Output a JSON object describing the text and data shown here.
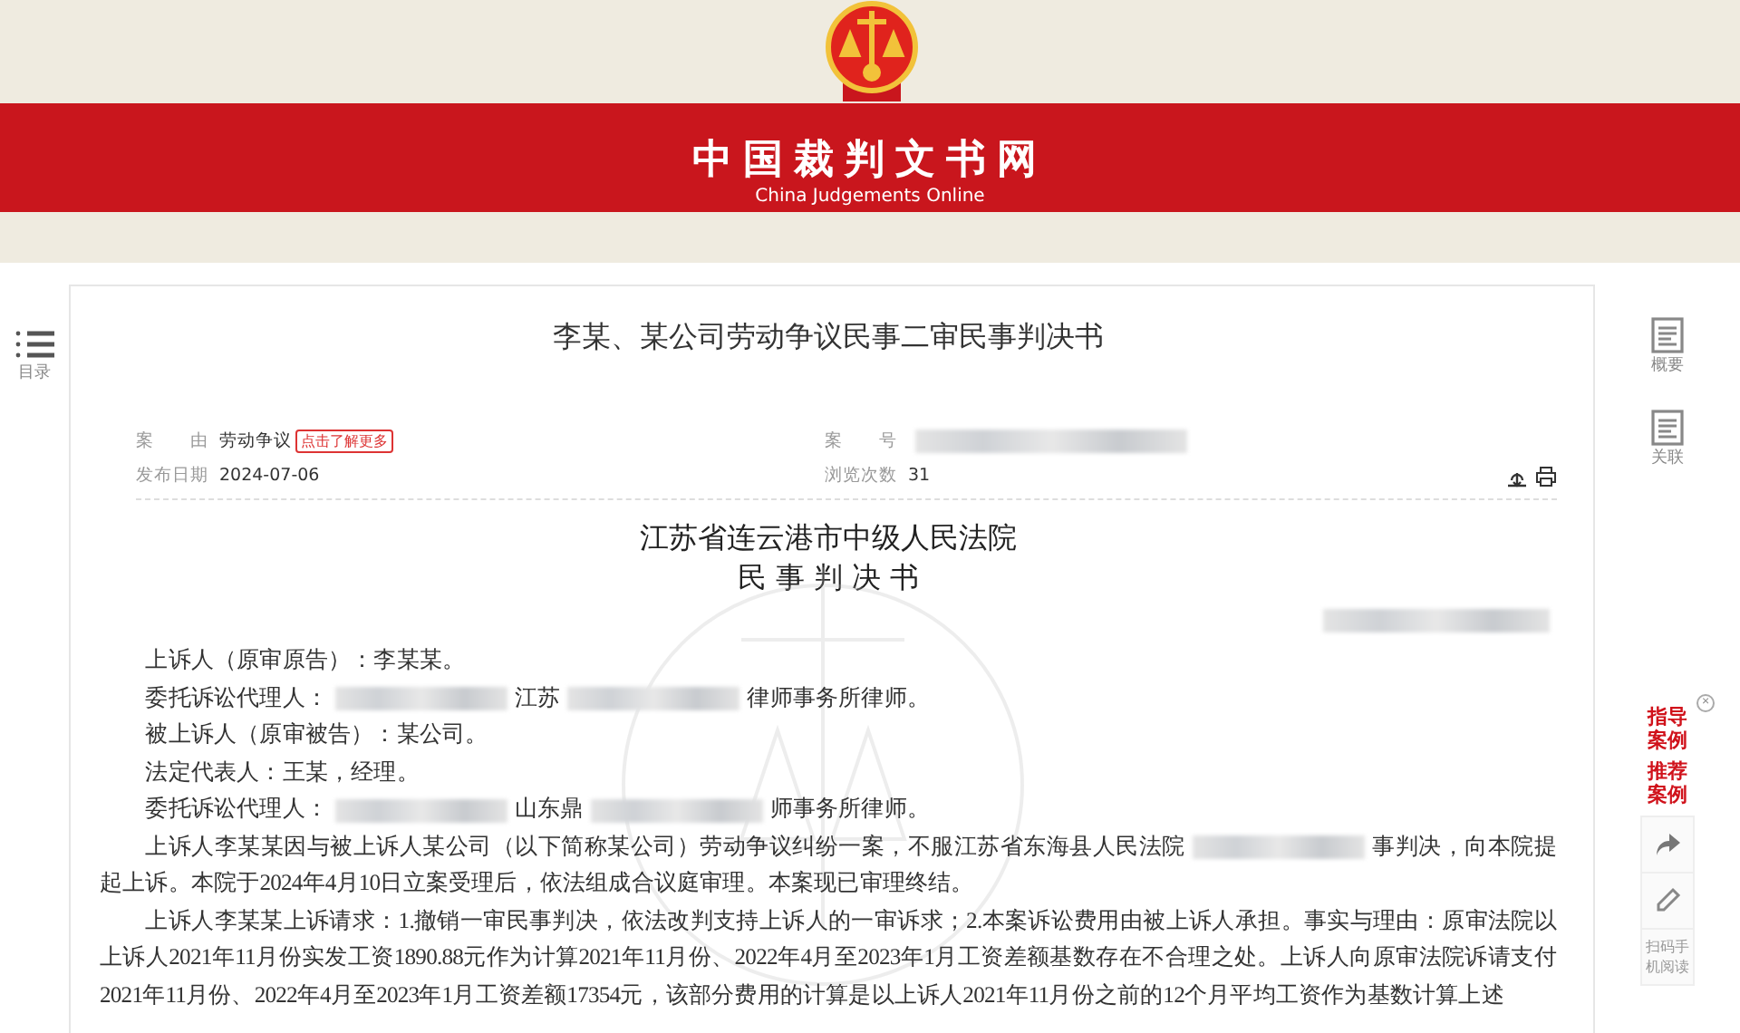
{
  "header": {
    "site_title": "中国裁判文书网",
    "site_subtitle": "China Judgements Online"
  },
  "toc": {
    "label": "目录"
  },
  "document": {
    "title": "李某、某公司劳动争议民事二审民事判决书",
    "meta": [
      {
        "kind": "value",
        "label": "案　　由",
        "value": "劳动争议",
        "badge": "点击了解更多"
      },
      {
        "kind": "redacted",
        "label": "案　　号"
      },
      {
        "kind": "value",
        "label": "发布日期",
        "value": "2024-07-06"
      },
      {
        "kind": "value",
        "label": "浏览次数",
        "value": "31"
      }
    ],
    "court": "江苏省连云港市中级人民法院",
    "doc_type": "民 事 判 决 书",
    "paragraphs": [
      [
        {
          "kind": "text",
          "text": "上诉人（原审原告）：李某某。"
        }
      ],
      [
        {
          "kind": "text",
          "text": "委托诉讼代理人："
        },
        {
          "kind": "redacted"
        },
        {
          "kind": "text",
          "text": "江苏"
        },
        {
          "kind": "redacted"
        },
        {
          "kind": "text",
          "text": "律师事务所律师。"
        }
      ],
      [
        {
          "kind": "text",
          "text": "被上诉人（原审被告）：某公司。"
        }
      ],
      [
        {
          "kind": "text",
          "text": "法定代表人：王某，经理。"
        }
      ],
      [
        {
          "kind": "text",
          "text": "委托诉讼代理人："
        },
        {
          "kind": "redacted"
        },
        {
          "kind": "text",
          "text": "山东鼎"
        },
        {
          "kind": "redacted"
        },
        {
          "kind": "text",
          "text": "师事务所律师。"
        }
      ],
      [
        {
          "kind": "text",
          "text": "上诉人李某某因与被上诉人某公司（以下简称某公司）劳动争议纠纷一案，不服江苏省东海县人民法院"
        },
        {
          "kind": "redacted"
        },
        {
          "kind": "text",
          "text": "事判决，向本院提起上诉。本院于2024年4月10日立案受理后，依法组成合议庭审理。本案现已审理终结。"
        }
      ],
      [
        {
          "kind": "text",
          "text": "上诉人李某某上诉请求：1.撤销一审民事判决，依法改判支持上诉人的一审诉求；2.本案诉讼费用由被上诉人承担。事实与理由：原审法院以上诉人2021年11月份实发工资1890.88元作为计算2021年11月份、2022年4月至2023年1月工资差额基数存在不合理之处。上诉人向原审法院诉请支付2021年11月份、2022年4月至2023年1月工资差额17354元，该部分费用的计算是以上诉人2021年11月份之前的12个月平均工资作为基数计算上述"
        }
      ]
    ]
  },
  "side_tools": [
    {
      "kind": "doc",
      "label": "概要"
    },
    {
      "kind": "doc",
      "label": "关联"
    }
  ],
  "promo": {
    "links": [
      "指导案例",
      "推荐案例"
    ],
    "close": "×"
  },
  "float_tools": [
    {
      "kind": "share"
    },
    {
      "kind": "edit"
    },
    {
      "kind": "text",
      "label": "扫码手机阅读"
    }
  ]
}
